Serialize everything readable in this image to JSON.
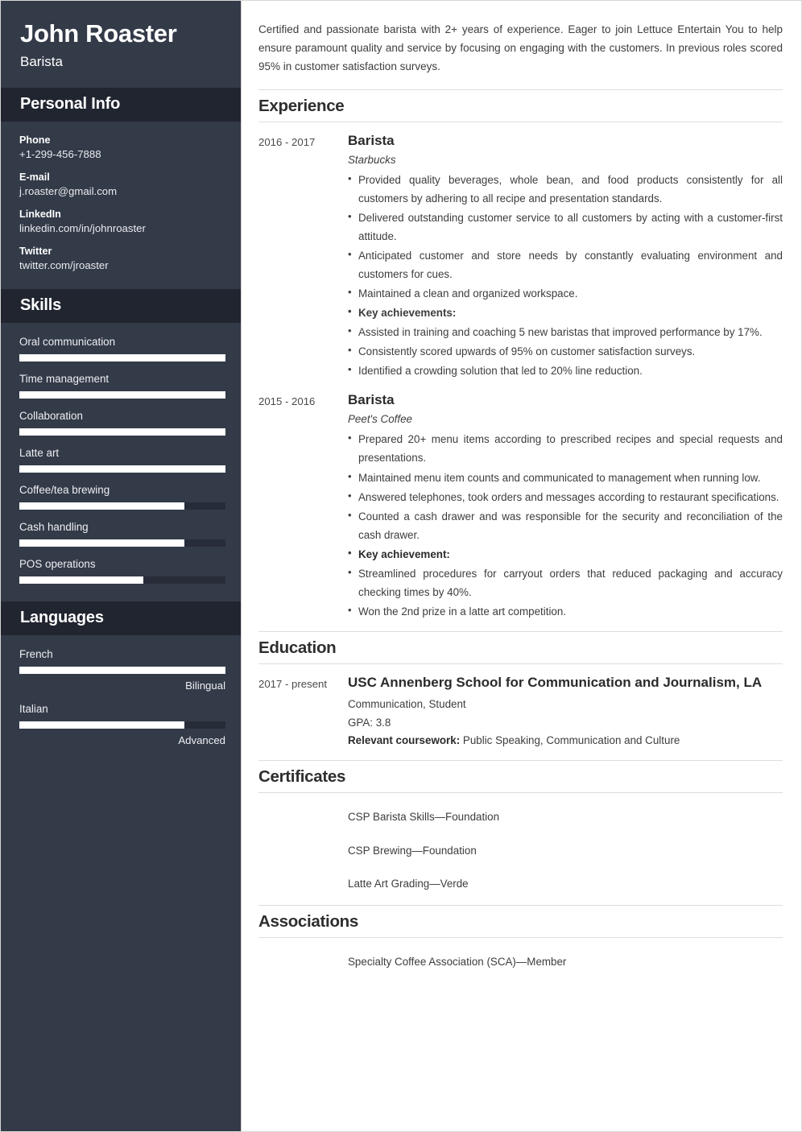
{
  "sidebar": {
    "name": "John Roaster",
    "job_title": "Barista",
    "personal_info": {
      "heading": "Personal Info",
      "items": [
        {
          "label": "Phone",
          "value": "+1-299-456-7888"
        },
        {
          "label": "E-mail",
          "value": "j.roaster@gmail.com"
        },
        {
          "label": "LinkedIn",
          "value": "linkedin.com/in/johnroaster"
        },
        {
          "label": "Twitter",
          "value": "twitter.com/jroaster"
        }
      ]
    },
    "skills": {
      "heading": "Skills",
      "items": [
        {
          "label": "Oral communication",
          "percent": 100
        },
        {
          "label": "Time management",
          "percent": 100
        },
        {
          "label": "Collaboration",
          "percent": 100
        },
        {
          "label": "Latte art",
          "percent": 100
        },
        {
          "label": "Coffee/tea brewing",
          "percent": 80
        },
        {
          "label": "Cash handling",
          "percent": 80
        },
        {
          "label": "POS operations",
          "percent": 60
        }
      ]
    },
    "languages": {
      "heading": "Languages",
      "items": [
        {
          "label": "French",
          "percent": 100,
          "level": "Bilingual"
        },
        {
          "label": "Italian",
          "percent": 80,
          "level": "Advanced"
        }
      ]
    }
  },
  "main": {
    "summary": "Certified and passionate barista with 2+ years of experience. Eager to join Lettuce Entertain You to help ensure paramount quality and service by focusing on engaging with the customers. In previous roles scored 95% in customer satisfaction surveys.",
    "experience": {
      "heading": "Experience",
      "entries": [
        {
          "date": "2016 - 2017",
          "title": "Barista",
          "subtitle": "Starbucks",
          "bullets": [
            "Provided quality beverages, whole bean, and food products consistently for all customers by adhering to all recipe and presentation standards.",
            "Delivered outstanding customer service to all customers by acting with a customer-first attitude.",
            "Anticipated customer and store needs by constantly evaluating environment and customers for cues.",
            "Maintained a clean and organized workspace."
          ],
          "achievements_label": "Key achievements:",
          "achievements_label_bulleted": false,
          "achievements": [
            "Assisted in training and coaching 5 new baristas that improved performance by 17%.",
            "Consistently scored upwards of 95% on customer satisfaction surveys.",
            "Identified a crowding solution that led to 20% line reduction."
          ]
        },
        {
          "date": "2015 - 2016",
          "title": "Barista",
          "subtitle": "Peet's Coffee",
          "bullets": [
            "Prepared 20+ menu items according to prescribed recipes and special requests and presentations.",
            "Maintained menu item counts and communicated to management when running low.",
            "Answered telephones, took orders and messages according to restaurant specifications.",
            "Counted a cash drawer and was responsible for the security and reconciliation of the cash drawer."
          ],
          "achievements_label": "Key achievement:",
          "achievements_label_bulleted": true,
          "achievements": [
            "Streamlined procedures for carryout orders that reduced packaging and accuracy checking times by 40%.",
            "Won the 2nd prize in a latte art competition."
          ]
        }
      ]
    },
    "education": {
      "heading": "Education",
      "entries": [
        {
          "date": "2017 - present",
          "title": "USC Annenberg School for Communication and Journalism, LA",
          "line1": "Communication, Student",
          "line2": "GPA: 3.8",
          "coursework_label": "Relevant coursework:",
          "coursework_value": "Public Speaking, Communication and Culture"
        }
      ]
    },
    "certificates": {
      "heading": "Certificates",
      "items": [
        "CSP Barista Skills—Foundation",
        "CSP Brewing—Foundation",
        "Latte Art Grading—Verde"
      ]
    },
    "associations": {
      "heading": "Associations",
      "items": [
        "Specialty Coffee Association (SCA)—Member"
      ]
    }
  }
}
